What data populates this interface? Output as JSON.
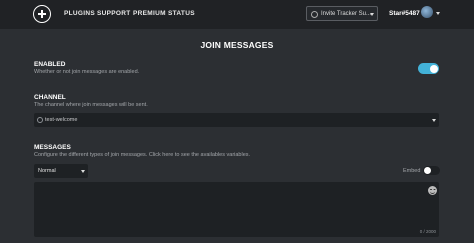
{
  "nav": {
    "links": [
      "PLUGINS",
      "SUPPORT",
      "PREMIUM",
      "STATUS"
    ],
    "server_name": "Invite Tracker Su...",
    "username": "Star#5487"
  },
  "page": {
    "title": "JOIN MESSAGES"
  },
  "enabled": {
    "title": "ENABLED",
    "description": "Whether or not join messages are enabled.",
    "is_on": true,
    "accent_color": "#43b2d8"
  },
  "channel": {
    "title": "CHANNEL",
    "description": "The channel where join messages will be sent.",
    "selected": "test-welcome"
  },
  "messages": {
    "title": "MESSAGES",
    "description": "Configure the different types of join messages. Click here to see the availables variables.",
    "type_selected": "Normal",
    "embed_label": "Embed",
    "embed_on": false,
    "text_value": "",
    "char_count": "0 / 2000"
  }
}
